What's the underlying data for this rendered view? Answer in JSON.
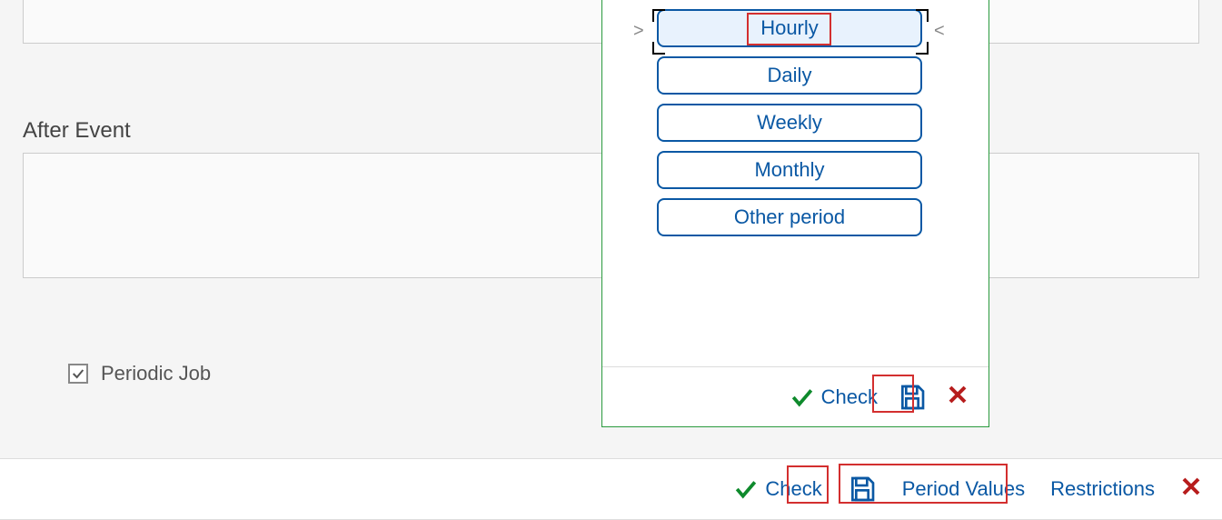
{
  "after_event_label": "After Event",
  "periodic_job": {
    "label": "Periodic Job",
    "checked": true
  },
  "popup": {
    "options": [
      "Hourly",
      "Daily",
      "Weekly",
      "Monthly",
      "Other period"
    ],
    "selected_index": 0,
    "footer": {
      "check_label": "Check"
    }
  },
  "bottombar": {
    "check_label": "Check",
    "period_values_label": "Period Values",
    "restrictions_label": "Restrictions"
  }
}
